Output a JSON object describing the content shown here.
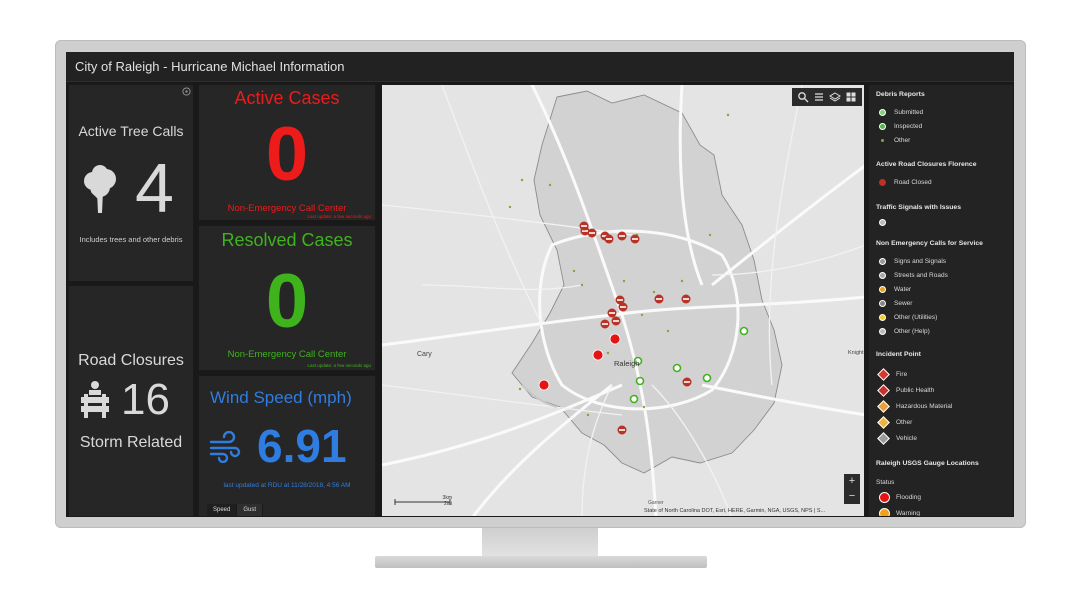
{
  "app": {
    "title": "City of Raleigh - Hurricane Michael Information"
  },
  "tree_calls": {
    "title": "Active Tree Calls",
    "count": "4",
    "subtitle": "Includes trees and other debris"
  },
  "road_closures": {
    "title": "Road Closures",
    "count": "16",
    "subtitle": "Storm Related"
  },
  "active_cases": {
    "title": "Active Cases",
    "count": "0",
    "subtitle": "Non-Emergency Call Center",
    "updated": "Last update: a few seconds ago",
    "color": "#ee1b1b"
  },
  "resolved_cases": {
    "title": "Resolved Cases",
    "count": "0",
    "subtitle": "Non-Emergency Call Center",
    "updated": "Last update: a few seconds ago",
    "color": "#3fb31c"
  },
  "wind": {
    "title": "Wind Speed (mph)",
    "value": "6.91",
    "updated": "last updated at RDU at 11/28/2018, 4:56 AM",
    "tabs": [
      "Speed",
      "Gust"
    ],
    "active_tab": "Speed",
    "color": "#2f7de0"
  },
  "map": {
    "city_label": "Raleigh",
    "place_labels": [
      "Cary",
      "Knight"
    ],
    "scale_top": "3km",
    "scale_bottom": "2mi",
    "garner_label": "Garner",
    "attribution": "State of North Carolina DOT, Esri, HERE, Garmin, NGA, USGS, NPS | S...",
    "tools": [
      "search-icon",
      "list-icon",
      "layers-icon",
      "basemap-icon"
    ],
    "zoom_in": "+",
    "zoom_out": "−"
  },
  "legend": {
    "debris_title": "Debris Reports",
    "debris_items": [
      "Submitted",
      "Inspected",
      "Other"
    ],
    "closures_title": "Active Road Closures Florence",
    "closures_item": "Road Closed",
    "signals_title": "Traffic Signals with Issues",
    "calls_title": "Non Emergency Calls for Service",
    "calls_items": [
      "Signs and Signals",
      "Streets and Roads",
      "Water",
      "Sewer",
      "Other (Utilities)",
      "Other (Help)"
    ],
    "incident_title": "Incident Point",
    "incident_items": [
      "Fire",
      "Public Health",
      "Hazardous Material",
      "Other",
      "Vehicle"
    ],
    "gauge_title": "Raleigh USGS Gauge Locations",
    "gauge_status": "Status",
    "gauge_items": [
      "Flooding",
      "Warning"
    ]
  }
}
